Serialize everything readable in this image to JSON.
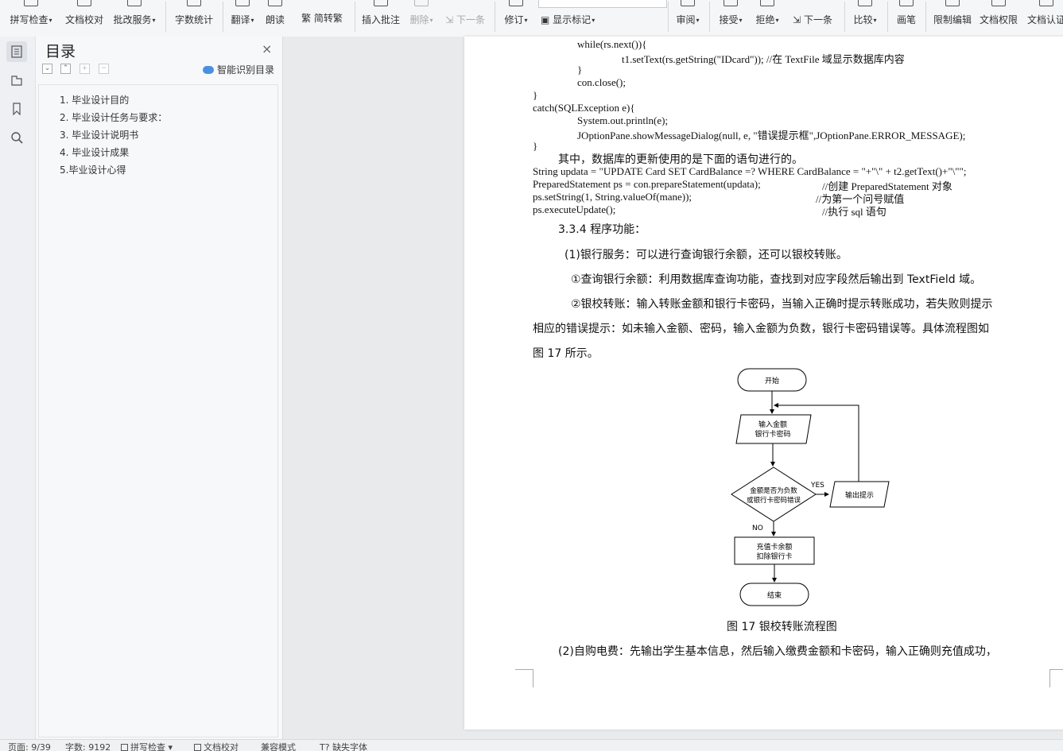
{
  "ribbon": {
    "items": [
      {
        "label": "拼写检查",
        "dropdown": true
      },
      {
        "label": "文档校对",
        "dropdown": false
      },
      {
        "label": "批改服务",
        "dropdown": true
      },
      {
        "label": "字数统计",
        "dropdown": false
      },
      {
        "label": "翻译",
        "dropdown": true
      },
      {
        "label": "朗读",
        "dropdown": false
      },
      {
        "label": "简转繁",
        "dropdown": false
      },
      {
        "label": "插入批注",
        "dropdown": false
      },
      {
        "label": "删除",
        "dropdown": true
      },
      {
        "label": "下一条",
        "dropdown": false
      },
      {
        "label": "修订",
        "dropdown": true
      },
      {
        "label": "显示标记",
        "dropdown": true
      },
      {
        "label": "审阅",
        "dropdown": true
      },
      {
        "label": "接受",
        "dropdown": true
      },
      {
        "label": "拒绝",
        "dropdown": true
      },
      {
        "label": "下一条",
        "dropdown": false
      },
      {
        "label": "比较",
        "dropdown": true
      },
      {
        "label": "画笔",
        "dropdown": false
      },
      {
        "label": "限制编辑",
        "dropdown": false
      },
      {
        "label": "文档权限",
        "dropdown": false
      },
      {
        "label": "文档认证",
        "dropdown": false
      }
    ]
  },
  "toc": {
    "title": "目录",
    "close": "×",
    "smart_label": "智能识别目录",
    "items": [
      "1. 毕业设计目的",
      "2. 毕业设计任务与要求：",
      "3. 毕业设计说明书",
      "4. 毕业设计成果",
      "5.毕业设计心得"
    ]
  },
  "doc": {
    "code1": [
      "while(rs.next()){",
      "t1.setText(rs.getString(\"IDcard\"));        //在 TextFile 域显示数据库内容",
      "}",
      "con.close();",
      "}",
      "catch(SQLException e){",
      "System.out.println(e);",
      "JOptionPane.showMessageDialog(null, e, \"错误提示框\",JOptionPane.ERROR_MESSAGE);",
      "}"
    ],
    "para_update": "其中，数据库的更新使用的是下面的语句进行的。",
    "code2": [
      "String updata = \"UPDATE Card SET CardBalance =? WHERE CardBalance = \"+\"\\\" + t2.getText()+\"\\\"\";",
      "PreparedStatement ps = con.prepareStatement(updata);",
      "ps.setString(1, String.valueOf(mane));",
      "ps.executeUpdate();"
    ],
    "code2_comments": [
      "//创建 PreparedStatement 对象",
      "//为第一个问号赋值",
      "//执行 sql 语句"
    ],
    "heading": "3.3.4 程序功能：",
    "p1": "(1)银行服务：可以进行查询银行余额，还可以银校转账。",
    "p2": "①查询银行余额：利用数据库查询功能，查找到对应字段然后输出到 TextField 域。",
    "p3a": "②银校转账：输入转账金额和银行卡密码，当输入正确时提示转账成功，若失败则提示",
    "p3b": "相应的错误提示：如未输入金额、密码，输入金额为负数，银行卡密码错误等。具体流程图如",
    "p3c": "图 17 所示。",
    "p4": "(2)自购电费：先输出学生基本信息，然后输入缴费金额和卡密码，输入正确则充值成功，",
    "caption": "图 17   银校转账流程图"
  },
  "flowchart": {
    "start": "开始",
    "input_line1": "输入金额",
    "input_line2": "银行卡密码",
    "decision_line1": "金额是否为负数",
    "decision_line2": "或银行卡密码错误",
    "yes": "YES",
    "no": "NO",
    "output": "输出提示",
    "process_line1": "充值卡余额",
    "process_line2": "扣除银行卡",
    "end": "结束"
  },
  "status": {
    "page": "页面: 9/39",
    "words": "字数: 9192",
    "spell": "拼写检查",
    "proof": "文档校对",
    "compat": "兼容模式",
    "missing_font": "缺失字体"
  }
}
